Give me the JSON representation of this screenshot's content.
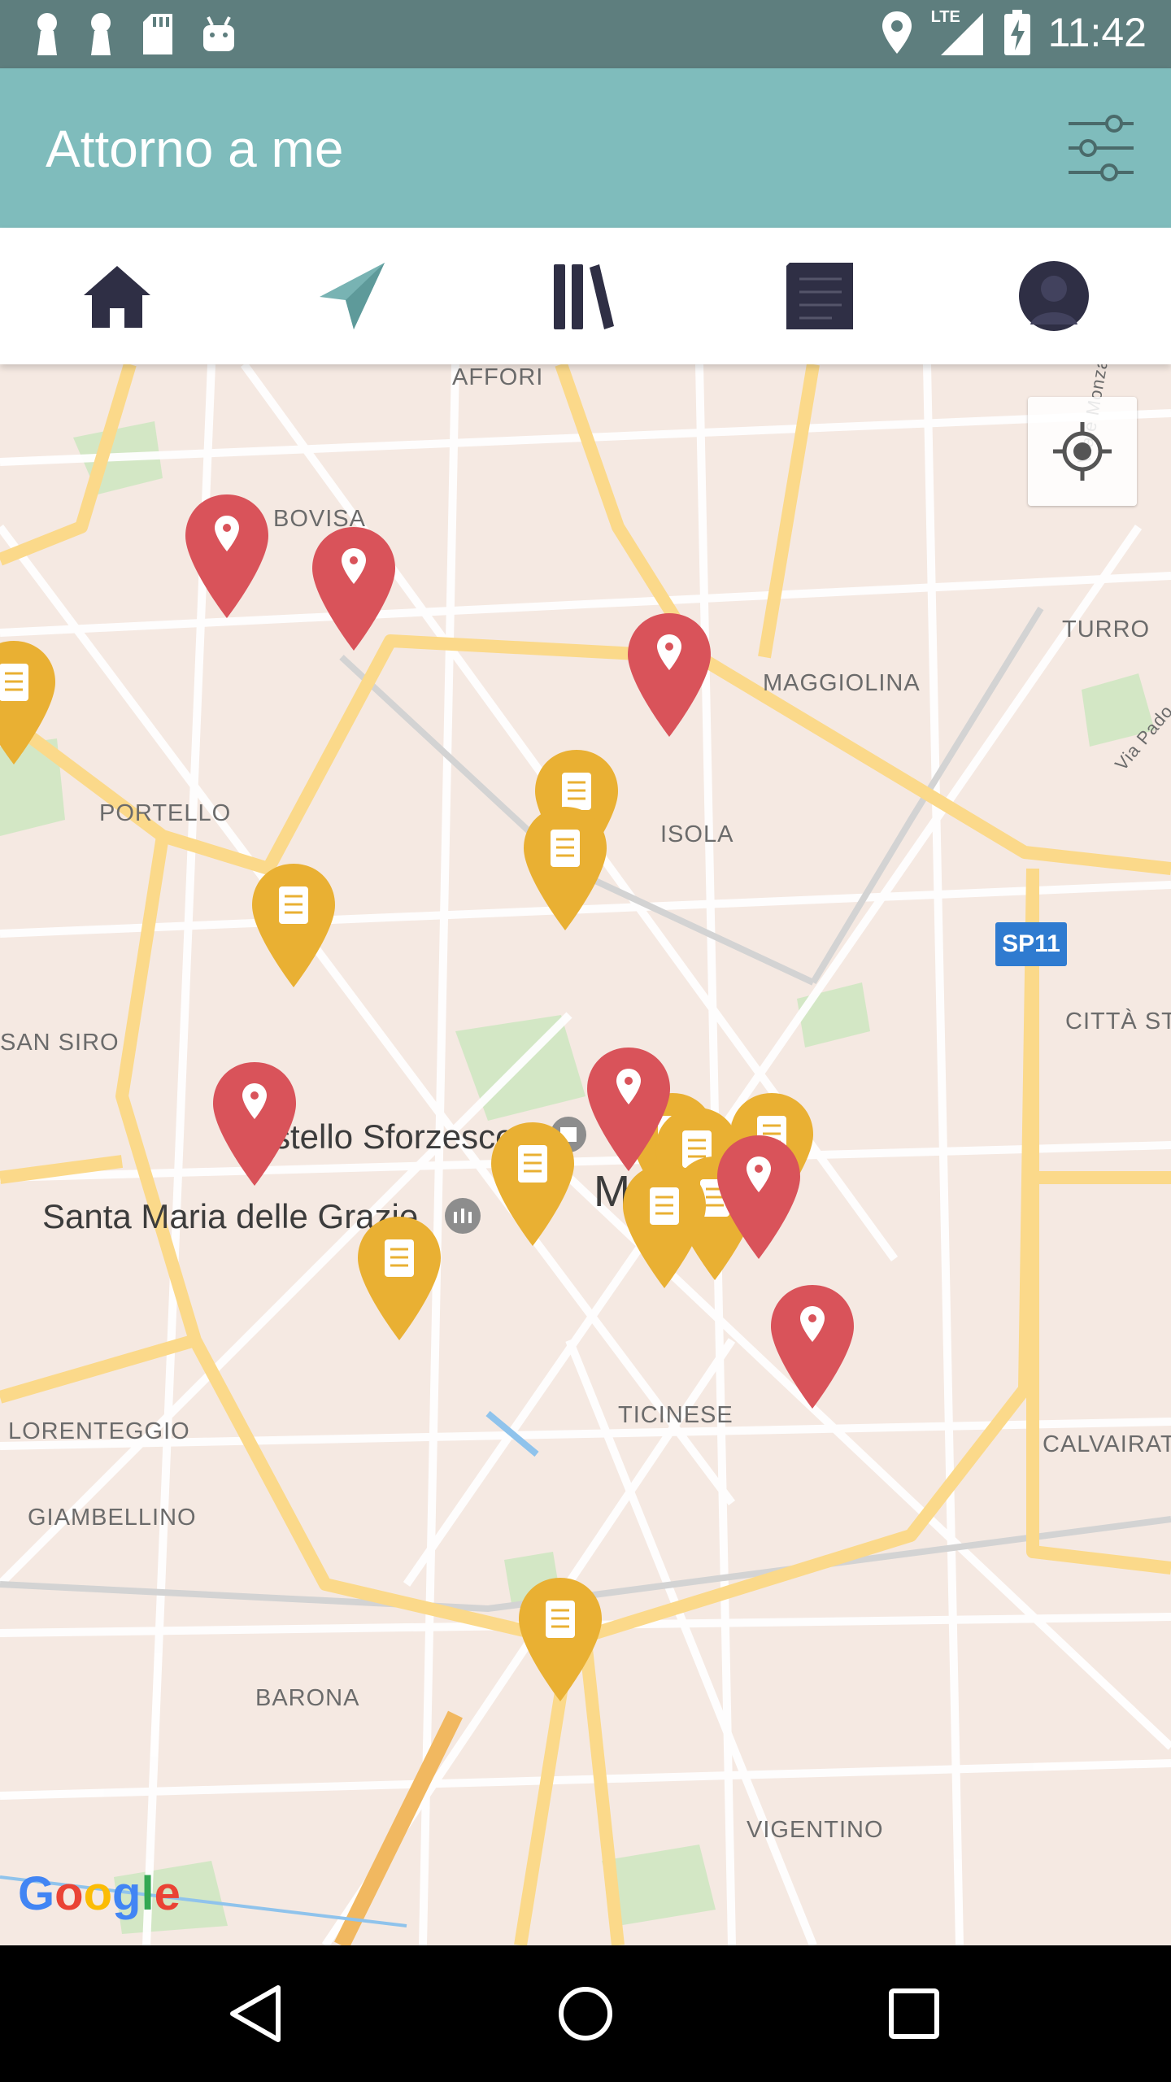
{
  "status_bar": {
    "time": "11:42",
    "network": "LTE",
    "icons": [
      "notification-icon",
      "notification-icon",
      "sd-card-icon",
      "android-icon",
      "location-icon",
      "signal-icon",
      "battery-charging-icon"
    ]
  },
  "app_bar": {
    "title": "Attorno a me",
    "filter_icon": "sliders-icon",
    "background": "#7fbcbc"
  },
  "tabs": [
    {
      "icon": "home-icon"
    },
    {
      "icon": "navigation-arrow-icon"
    },
    {
      "icon": "library-icon"
    },
    {
      "icon": "document-icon"
    },
    {
      "icon": "profile-icon"
    }
  ],
  "map": {
    "labels": {
      "affori": "AFFORI",
      "bovisa": "BOVISA",
      "turro": "TURRO",
      "maggiolina": "MAGGIOLINA",
      "portello": "PORTELLO",
      "isola": "ISOLA",
      "san_siro": "SAN SIRO",
      "citta_studi": "CITTÀ ST",
      "castello": "stello Sforzesco",
      "santa_maria": "Santa Maria delle Grazie",
      "milano": "M",
      "lorenteggio": "LORENTEGGIO",
      "ticinese": "TICINESE",
      "calvairate": "CALVAIRAT",
      "giambellino": "GIAMBELLINO",
      "barona": "BARONA",
      "vigentino": "VIGENTINO",
      "viale_monza": "Viale Monza",
      "via_padova": "Via Pado"
    },
    "road_shield": "SP11",
    "attribution": "Google",
    "red_marker_color": "#d9535a",
    "yellow_marker_color": "#e9b033"
  },
  "nav_bar": {
    "back": "back-icon",
    "home": "home-circle-icon",
    "recents": "recents-icon"
  }
}
